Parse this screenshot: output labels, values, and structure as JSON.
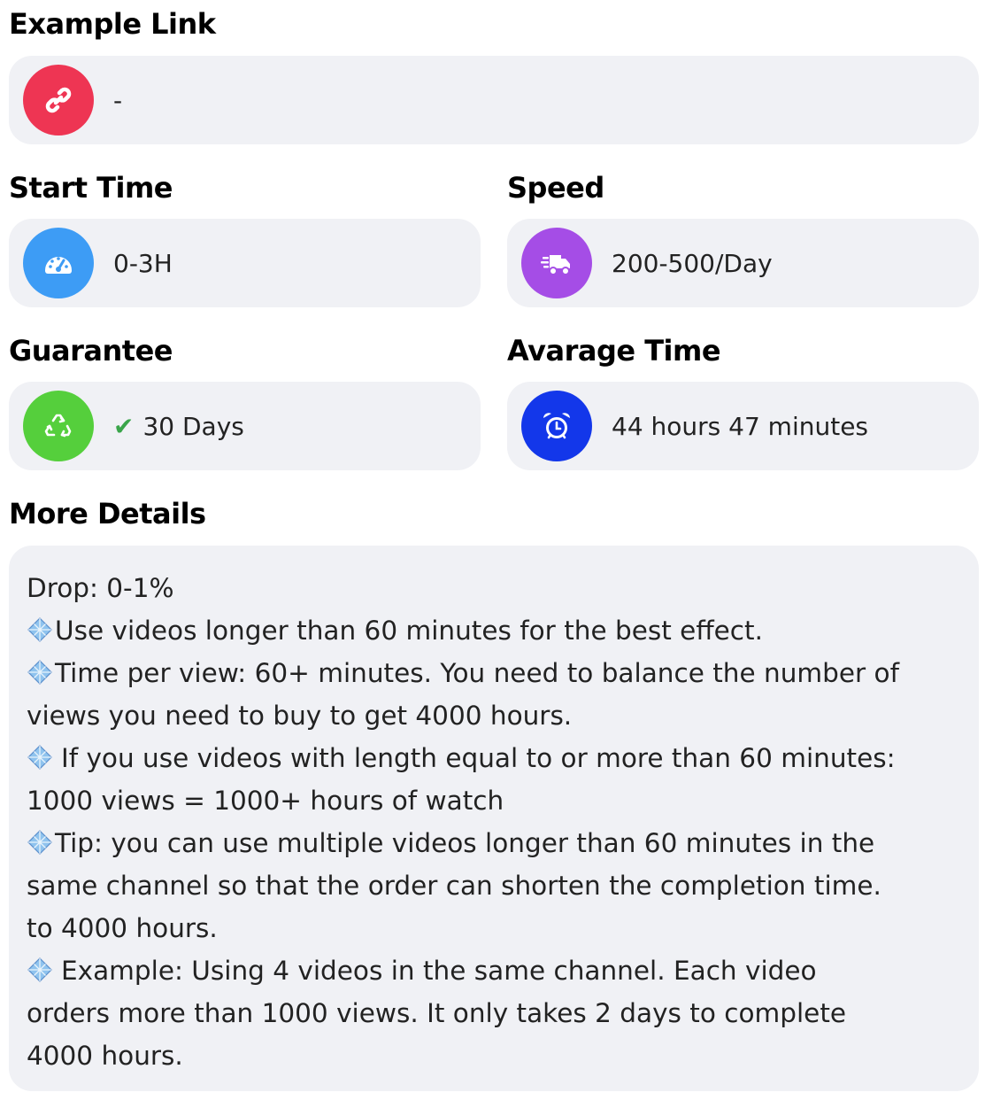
{
  "example_link": {
    "label": "Example Link",
    "value": "-",
    "icon": "link-icon",
    "icon_color": "#ee3553"
  },
  "start_time": {
    "label": "Start Time",
    "value": "0-3H",
    "icon": "speedometer-icon",
    "icon_color": "#3d9cf5"
  },
  "speed": {
    "label": "Speed",
    "value": "200-500/Day",
    "icon": "fast-truck-icon",
    "icon_color": "#a54de6"
  },
  "guarantee": {
    "label": "Guarantee",
    "value": "30 Days",
    "check": "✔",
    "icon": "recycle-icon",
    "icon_color": "#55cf3c",
    "check_color": "#3aa54a"
  },
  "average_time": {
    "label": "Avarage Time",
    "value": "44 hours 47 minutes",
    "icon": "alarm-clock-icon",
    "icon_color": "#1337ea"
  },
  "more_details": {
    "label": "More Details",
    "bullet_icon": "diamond-gem-icon",
    "lines": [
      "Drop: 0-1%",
      "Use videos longer than 60 minutes for the best effect.",
      "Time per view: 60+ minutes. You need to balance the number of",
      "views you need to buy to get 4000 hours.",
      "If you use videos with length equal to or more than 60 minutes:",
      "1000 views = 1000+ hours of watch",
      "Tip: you can use multiple videos longer than 60 minutes in the",
      "same channel so that the order can shorten the completion time.",
      "to 4000 hours.",
      "Example: Using 4 videos in the same channel. Each video",
      "orders more than 1000 views. It only takes 2 days to complete",
      "4000 hours."
    ]
  }
}
